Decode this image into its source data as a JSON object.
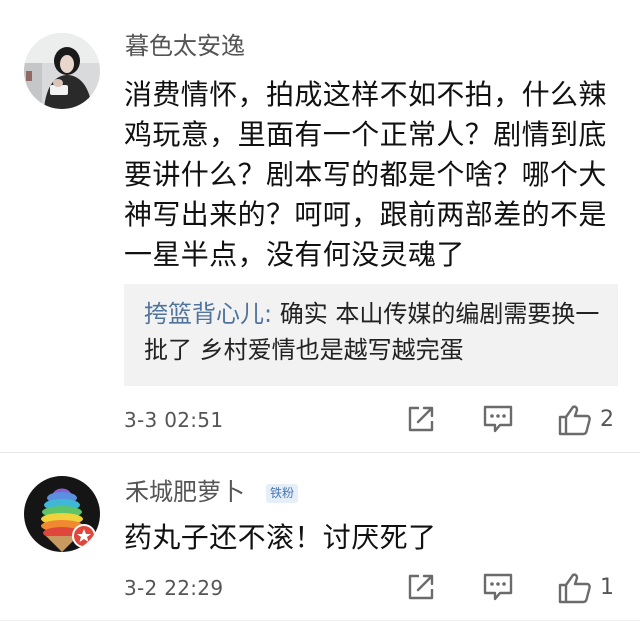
{
  "comments": [
    {
      "username": "暮色太安逸",
      "body": "消费情怀，拍成这样不如不拍，什么辣鸡玩意，里面有一个正常人？剧情到底要讲什么？剧本写的都是个啥？哪个大神写出来的？呵呵，跟前两部差的不是一星半点，没有何没灵魂了",
      "reply": {
        "author": "挎篮背心儿:",
        "text": " 确实 本山传媒的编剧需要换一批了 乡村爱情也是越写越完蛋"
      },
      "timestamp": "3-3 02:51",
      "likes": "2"
    },
    {
      "username": "禾城肥萝卜",
      "badge": "铁粉",
      "body": "药丸子还不滚！讨厌死了",
      "timestamp": "3-2 22:29",
      "likes": "1"
    }
  ],
  "icons": {
    "share": "share-icon",
    "comment": "comment-icon",
    "like": "thumbs-up-icon"
  },
  "colors": {
    "username": "#555555",
    "reply_author": "#50749e",
    "reply_background": "#f2f2f2",
    "icon": "#6b6b6b",
    "badge_text": "#4a78b5",
    "badge_background": "#e6eef8"
  }
}
